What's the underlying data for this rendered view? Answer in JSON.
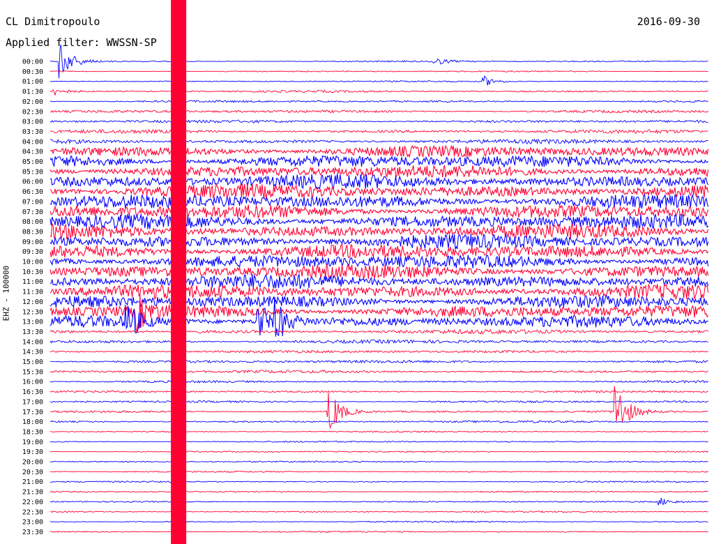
{
  "header": {
    "station": "CL Dimitropoulo",
    "date": "2016-09-30",
    "filter": "Applied filter: WWSSN-SP"
  },
  "channel_label": "EHZ - 100000",
  "colors": {
    "even_trace": "#0000ff",
    "odd_trace": "#ff0033",
    "background": "#ffffff",
    "text": "#000000"
  },
  "chart_data": {
    "type": "line",
    "title": "",
    "xlabel": "",
    "ylabel": "EHZ - 100000",
    "grid": false,
    "minutes_per_line": 30,
    "y_tick_labels": [
      "00:00",
      "00:30",
      "01:00",
      "01:30",
      "02:00",
      "02:30",
      "03:00",
      "03:30",
      "04:00",
      "04:30",
      "05:00",
      "05:30",
      "06:00",
      "06:30",
      "07:00",
      "07:30",
      "08:00",
      "08:30",
      "09:00",
      "09:30",
      "10:00",
      "10:30",
      "11:00",
      "11:30",
      "12:00",
      "12:30",
      "13:00",
      "13:30",
      "14:00",
      "14:30",
      "15:00",
      "15:30",
      "16:00",
      "16:30",
      "17:00",
      "17:30",
      "18:00",
      "18:30",
      "19:00",
      "19:30",
      "20:00",
      "20:30",
      "21:00",
      "21:30",
      "22:00",
      "22:30",
      "23:00",
      "23:30"
    ],
    "noise_amplitude": [
      0.1,
      0.1,
      0.1,
      0.15,
      0.15,
      0.2,
      0.2,
      0.25,
      0.3,
      0.8,
      0.9,
      0.9,
      1.0,
      1.0,
      1.0,
      1.0,
      1.0,
      1.0,
      1.0,
      1.0,
      1.0,
      1.0,
      1.0,
      1.0,
      0.9,
      0.9,
      0.8,
      0.3,
      0.25,
      0.2,
      0.2,
      0.2,
      0.15,
      0.15,
      0.15,
      0.15,
      0.15,
      0.1,
      0.1,
      0.1,
      0.1,
      0.1,
      0.1,
      0.1,
      0.1,
      0.1,
      0.1,
      0.1
    ],
    "events": [
      {
        "line": "00:00",
        "minute": 0.5,
        "amplitude": 3.2
      },
      {
        "line": "00:00",
        "minute": 17.5,
        "amplitude": 0.7
      },
      {
        "line": "01:00",
        "minute": 19.8,
        "amplitude": 0.8
      },
      {
        "line": "01:30",
        "minute": 0.2,
        "amplitude": 0.6
      },
      {
        "line": "12:30",
        "minute": 4.0,
        "amplitude": 2.5
      },
      {
        "line": "13:00",
        "minute": 3.5,
        "amplitude": 3.0
      },
      {
        "line": "13:00",
        "minute": 9.5,
        "amplitude": 3.5
      },
      {
        "line": "13:00",
        "minute": 10.3,
        "amplitude": 3.0
      },
      {
        "line": "17:30",
        "minute": 12.7,
        "amplitude": 4.0
      },
      {
        "line": "17:30",
        "minute": 25.8,
        "amplitude": 5.0
      },
      {
        "line": "22:00",
        "minute": 27.8,
        "amplitude": 0.6
      }
    ],
    "saturated_intervals": [
      {
        "line": "00:00",
        "minute_start": 5.5,
        "minute_end": 6.2
      }
    ]
  }
}
